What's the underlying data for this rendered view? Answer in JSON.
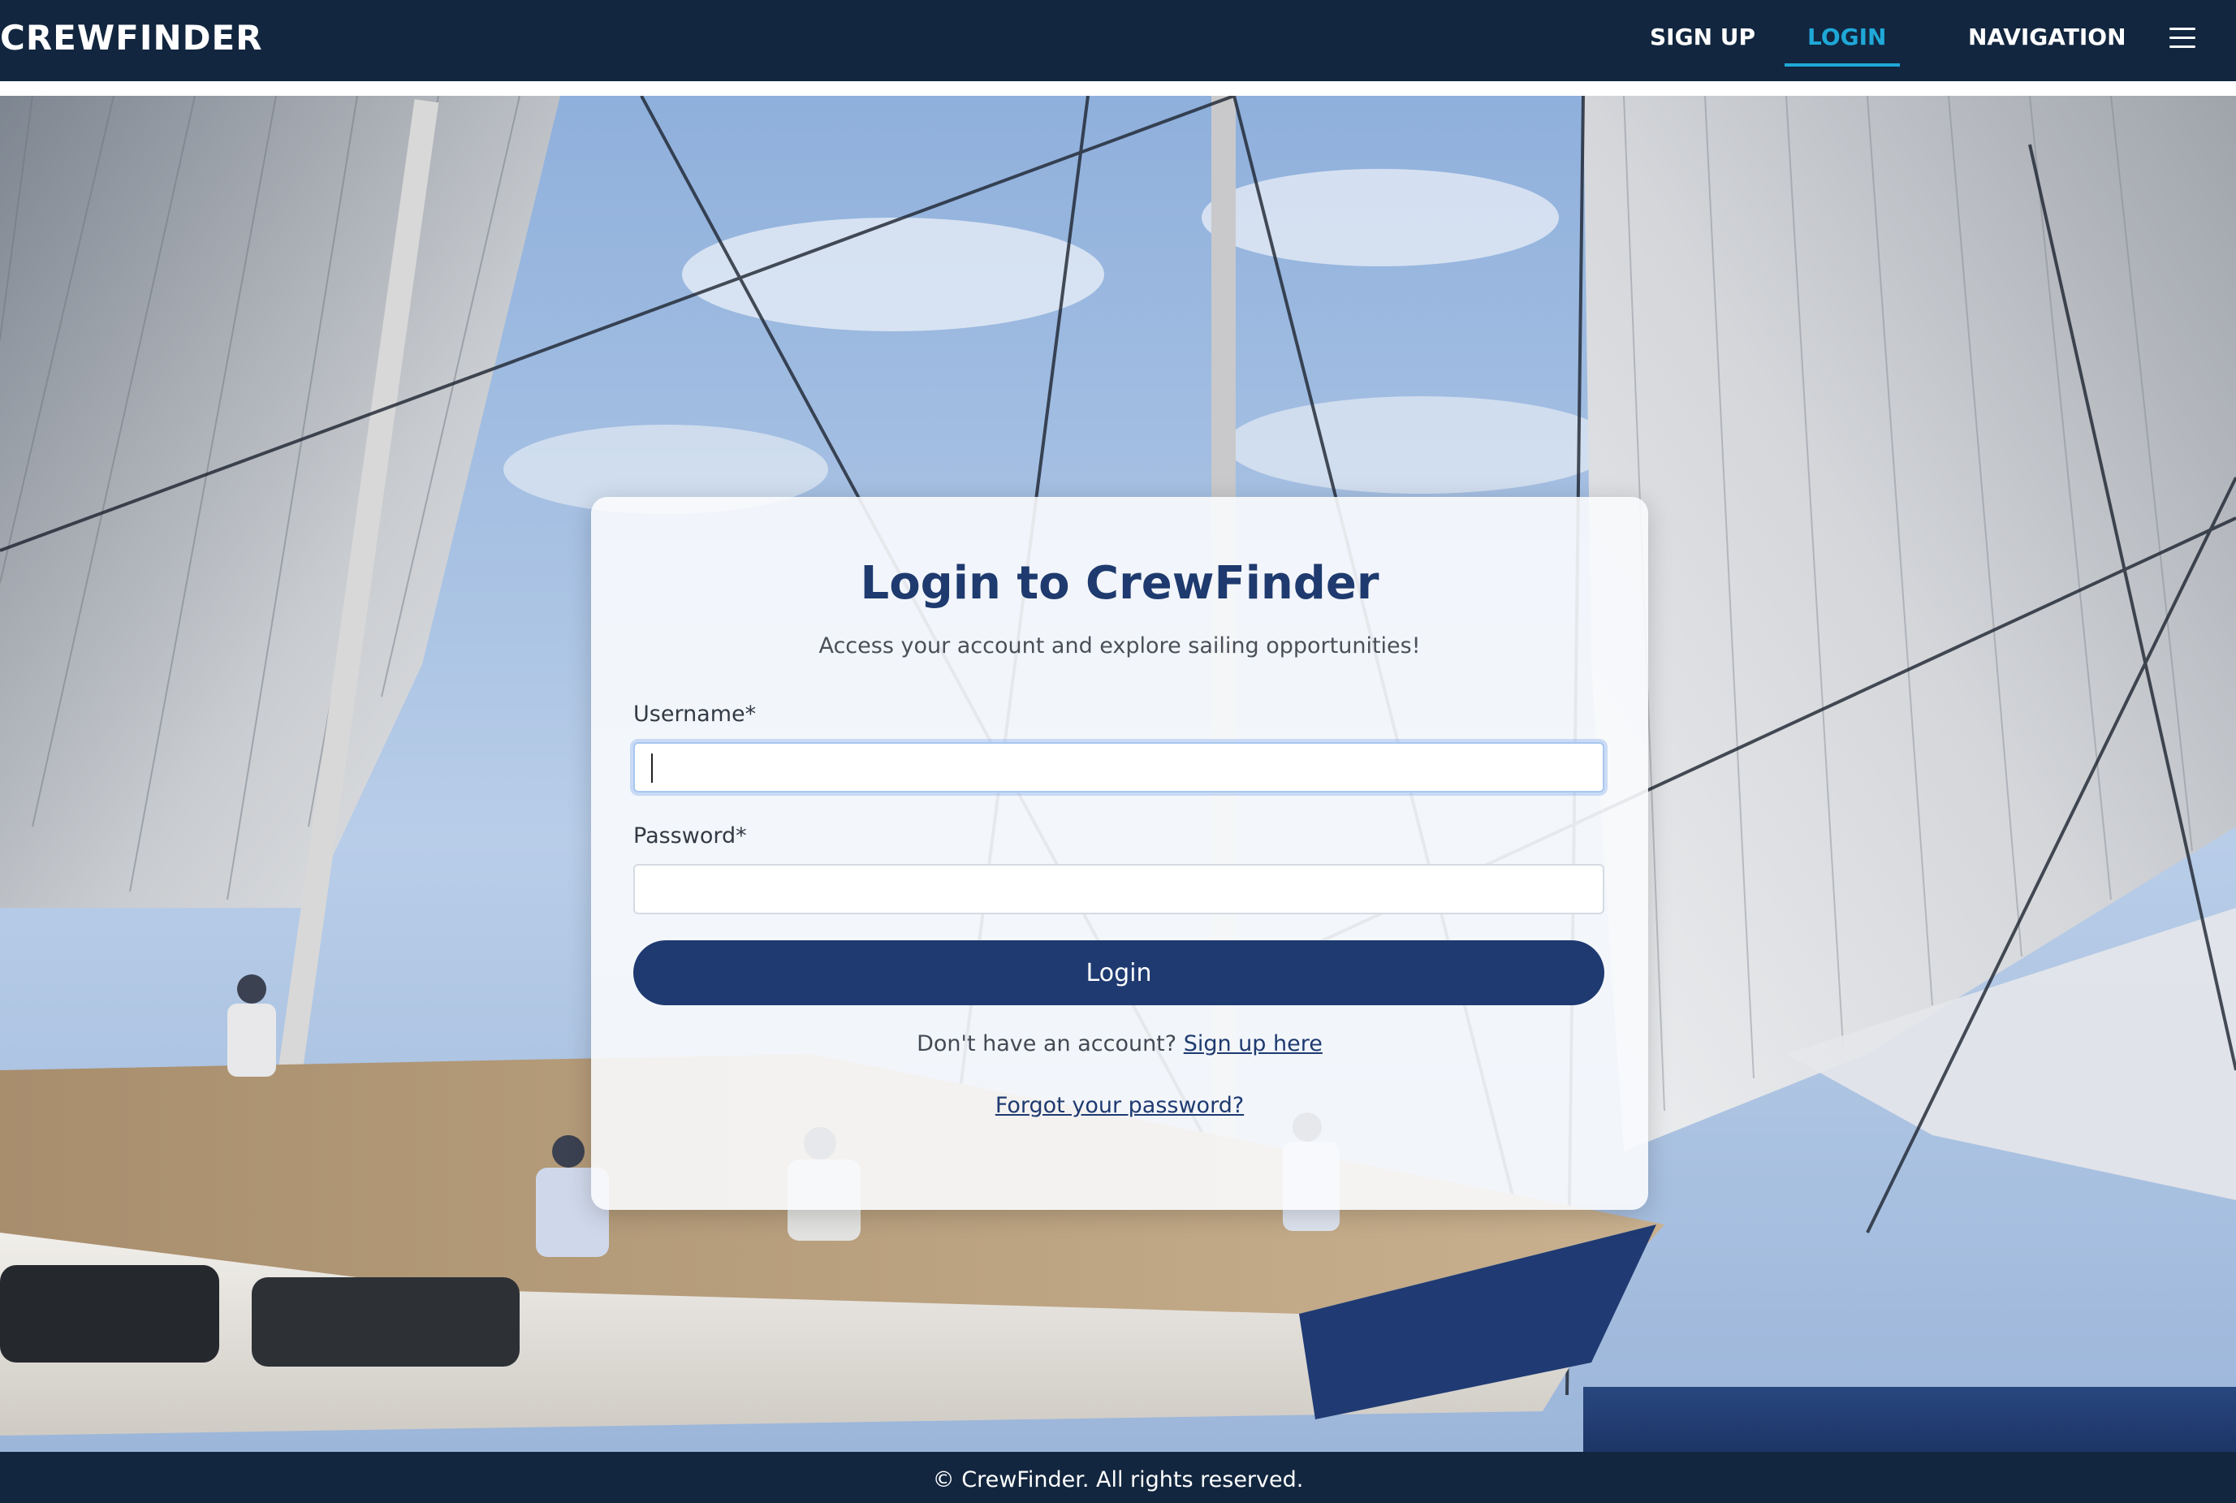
{
  "header": {
    "brand": "CREWFINDER",
    "nav": {
      "signup": "SIGN UP",
      "login": "LOGIN",
      "navigation": "NAVIGATION"
    },
    "menu_icon": "hamburger-menu-icon",
    "active_color": "#1fa8d8",
    "background_color": "#12263f"
  },
  "login_card": {
    "title": "Login to CrewFinder",
    "subtitle": "Access your account and explore sailing opportunities!",
    "username_label": "Username*",
    "username_value": "",
    "password_label": "Password*",
    "password_value": "",
    "login_button": "Login",
    "signup_prompt": "Don't have an account?",
    "signup_link": "Sign up here",
    "forgot_link": "Forgot your password?",
    "accent_color": "#1e3a70"
  },
  "footer": {
    "text": "© CrewFinder. All rights reserved."
  }
}
